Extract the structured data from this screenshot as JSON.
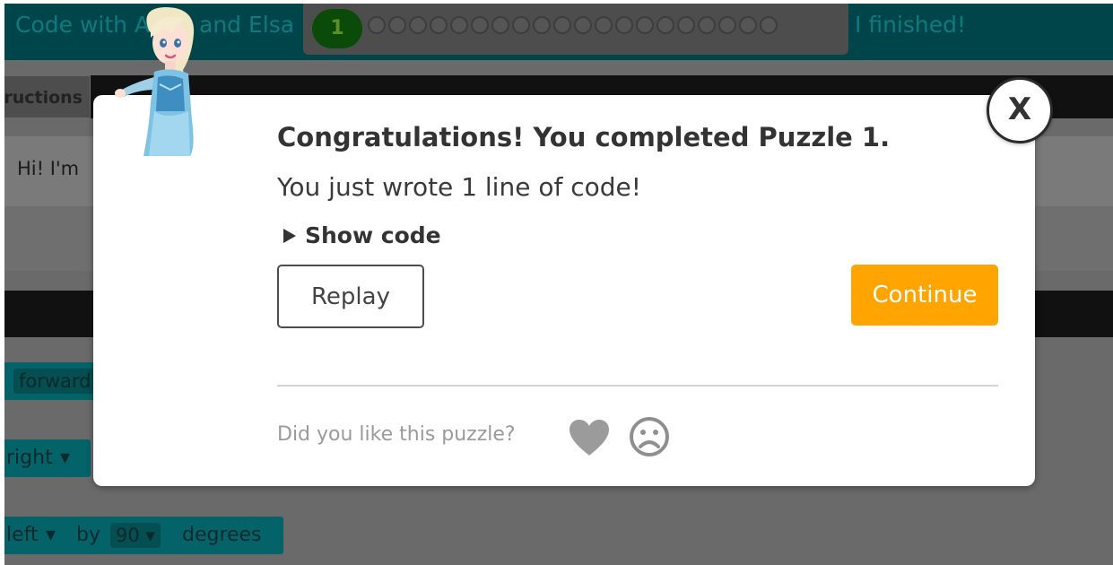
{
  "app": {
    "title": "Code with Anna and Elsa",
    "current_puzzle": "1",
    "puzzle_dot_count": 20,
    "finished_label": "I finished!",
    "instructions_tab": "Instructions",
    "instructions_text": "Hi! I'm",
    "blocks": [
      {
        "text": "forward"
      },
      {
        "text": "right"
      },
      {
        "dir": "left",
        "by": "by",
        "deg": "90",
        "unit": "degrees"
      }
    ]
  },
  "modal": {
    "title": "Congratulations! You completed Puzzle 1.",
    "subtitle": "You just wrote 1 line of code!",
    "show_code_label": "Show code",
    "replay_label": "Replay",
    "continue_label": "Continue",
    "feedback_label": "Did you like this puzzle?",
    "close_label": "X"
  },
  "colors": {
    "continue_bg": "#ffa400",
    "header_bg": "#00454a",
    "block_bg": "#036369"
  },
  "icons": [
    "heart-icon",
    "frown-icon",
    "close-icon",
    "elsa-avatar"
  ]
}
